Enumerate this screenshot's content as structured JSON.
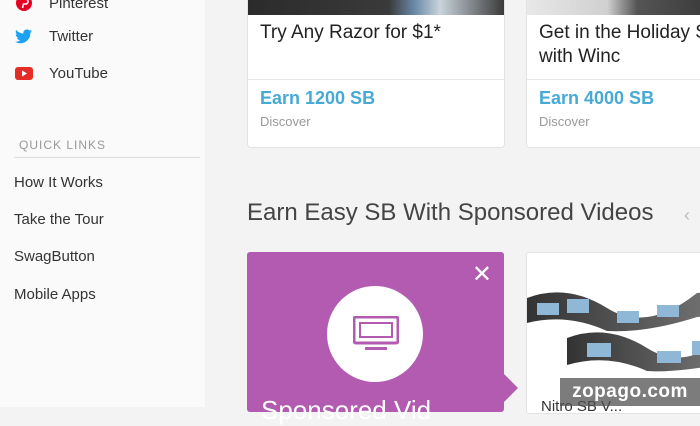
{
  "sidebar": {
    "social": [
      {
        "label": "Pinterest",
        "icon": "pinterest-icon",
        "color": "#e60023"
      },
      {
        "label": "Twitter",
        "icon": "twitter-icon",
        "color": "#1da1f2"
      },
      {
        "label": "YouTube",
        "icon": "youtube-icon",
        "color": "#e52d27"
      }
    ],
    "quick_links_heading": "QUICK LINKS",
    "quick_links": [
      "How It Works",
      "Take the Tour",
      "SwagButton",
      "Mobile Apps"
    ]
  },
  "offers": [
    {
      "title": "Try Any Razor for $1*",
      "earn": "Earn 1200 SB",
      "category": "Discover"
    },
    {
      "title": "Get in the Holiday S\nwith Winc",
      "earn": "Earn 4000 SB",
      "category": "Discover"
    }
  ],
  "videos_section": {
    "title": "Earn Easy SB With Sponsored Videos",
    "sponsored_caption": "Sponsored Vid",
    "second_caption": "Nitro SB V..."
  },
  "colors": {
    "accent_blue": "#47a9d6",
    "video_purple": "#b25bb1"
  },
  "watermark": "zopago.com"
}
